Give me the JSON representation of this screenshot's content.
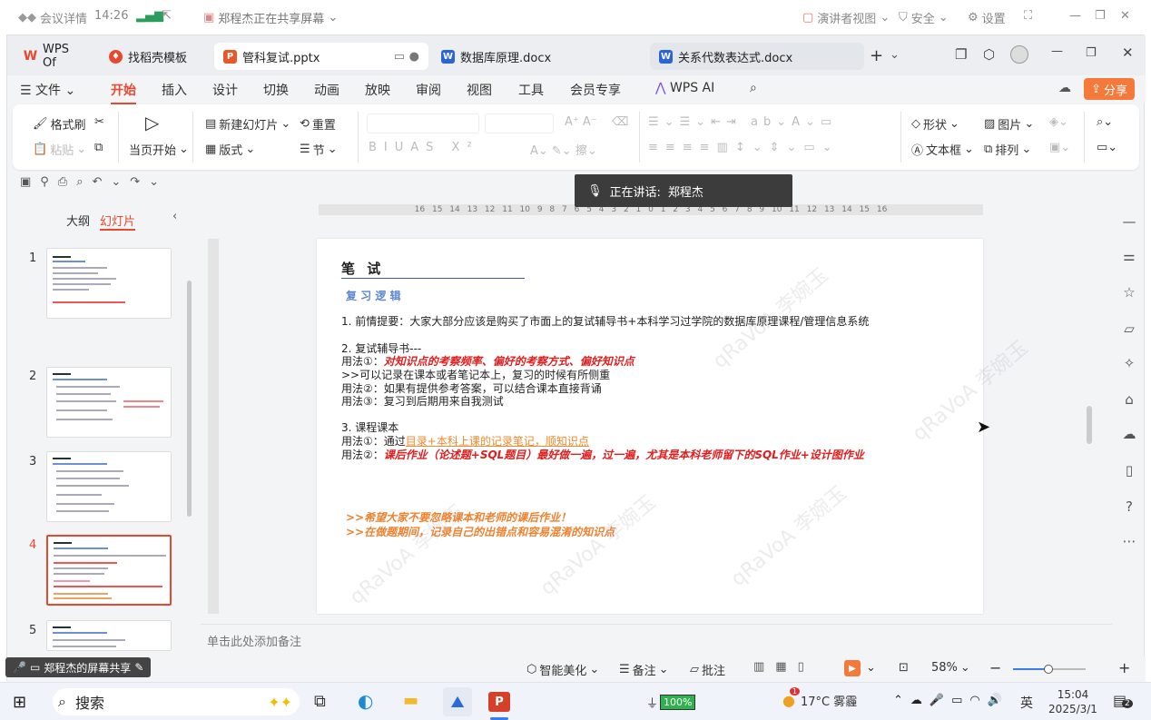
{
  "meeting": {
    "details": "会议详情",
    "time": "14:26",
    "sharing": "郑程杰正在共享屏幕",
    "presenter_view": "演讲者视图",
    "security": "安全",
    "settings": "设置"
  },
  "tabs": [
    {
      "label": "WPS Of"
    },
    {
      "label": "找稻壳模板"
    },
    {
      "label": "管科复试.pptx"
    },
    {
      "label": "数据库原理.docx"
    },
    {
      "label": "关系代数表达式.docx"
    }
  ],
  "menu": {
    "file": "文件",
    "items": [
      "开始",
      "插入",
      "设计",
      "切换",
      "动画",
      "放映",
      "审阅",
      "视图",
      "工具",
      "会员专享"
    ],
    "wps_ai": "WPS AI",
    "share": "分享"
  },
  "ribbon": {
    "format_painter": "格式刷",
    "paste": "粘贴",
    "from_current": "当页开始",
    "new_slide": "新建幻灯片",
    "layout": "版式",
    "reset": "重置",
    "section": "节",
    "shape": "形状",
    "picture": "图片",
    "textbox": "文本框",
    "arrange": "排列"
  },
  "panel": {
    "outline": "大纲",
    "slides": "幻灯片",
    "numbers": [
      "1",
      "2",
      "3",
      "4",
      "5"
    ]
  },
  "toast": {
    "speaking": "正在讲话:",
    "name": "郑程杰"
  },
  "ruler": {
    "h": "16 15 14 13 12 11 10 9 8 7 6 5 4 3 2 1 0 1 2 3 4 5 6 7 8 9 10 11 12 13 14 15 16"
  },
  "slide": {
    "title": "笔 试",
    "subtitle": "复   习   逻   辑",
    "l1": "1. 前情提要：大家大部分应该是购买了市面上的复试辅导书+本科学习过学院的数据库原理课程/管理信息系统",
    "l2": "2. 复试辅导书---",
    "l3a": "用法①：",
    "l3b": "对知识点的考察频率、偏好的考察方式、偏好知识点",
    "l4": ">>可以记录在课本或者笔记本上，复习的时候有所侧重",
    "l5": "用法②：如果有提供参考答案，可以结合课本直接背诵",
    "l6": "用法③：复习到后期用来自我测试",
    "l7": "3. 课程课本",
    "l8a": "用法①：通过",
    "l8b": "目录+本科上课的记录笔记，顺知识点",
    "l9a": "用法②：",
    "l9b": "课后作业（论述题+SQL题目）最好做一遍，过一遍，尤其是本科老师留下的SQL作业+设计图作业",
    "l10": ">>希望大家不要忽略课本和老师的课后作业！",
    "l11": ">>在做题期间，记录自己的出错点和容易混淆的知识点"
  },
  "watermark": "qRaVoA 李婉玉",
  "notes": "单击此处添加备注",
  "status": {
    "screen_share": "郑程杰的屏幕共享",
    "beautify": "智能美化",
    "notes": "备注",
    "comment": "批注",
    "zoom": "58%"
  },
  "taskbar": {
    "search": "搜索",
    "battery": "100%",
    "weather": "17°C 雾霾",
    "ime": "英",
    "time": "15:04",
    "date": "2025/3/1",
    "notif": "2",
    "weather_badge": "1"
  }
}
